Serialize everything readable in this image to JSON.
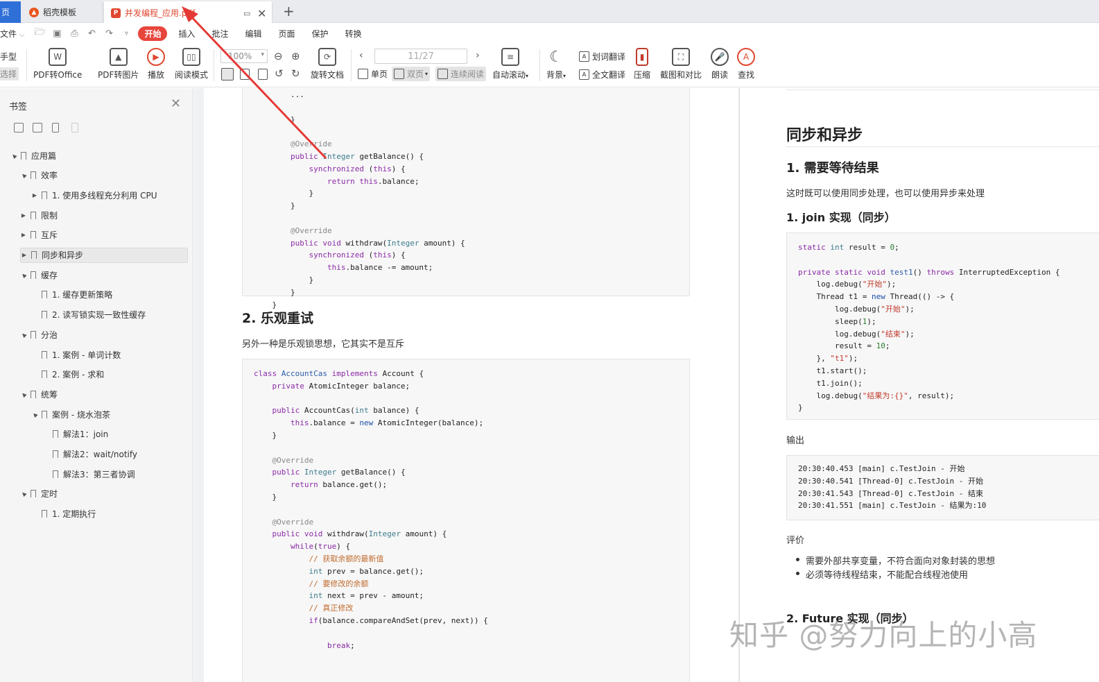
{
  "tabs": {
    "home_label": "页",
    "docer_label": "稻壳模板",
    "pdf_label": "并发编程_应用.pdf",
    "add_label": "+"
  },
  "menu": {
    "file_label": "文件",
    "start_label": "开始",
    "items": [
      "插入",
      "批注",
      "编辑",
      "页面",
      "保护",
      "转换"
    ]
  },
  "ribbon": {
    "hand_label": "手型",
    "select_label": "选择",
    "pdf_to_office": "PDF转Office",
    "pdf_to_image": "PDF转图片",
    "play": "播放",
    "read_mode": "阅读模式",
    "zoom": "100%",
    "rotate": "旋转文档",
    "page_indicator": "11/27",
    "single_page": "单页",
    "double_page": "双页",
    "continuous": "连续阅读",
    "auto_scroll": "自动滚动",
    "background": "背景",
    "word_translate": "划词翻译",
    "full_translate": "全文翻译",
    "compress": "压缩",
    "screenshot_compare": "截图和对比",
    "read_aloud": "朗读",
    "find": "查找"
  },
  "sidebar": {
    "title": "书签",
    "bookmarks": [
      {
        "label": "应用篇",
        "level": 0,
        "arrow": "▲"
      },
      {
        "label": "效率",
        "level": 1,
        "arrow": "▲"
      },
      {
        "label": "1. 使用多线程充分利用 CPU",
        "level": 2,
        "arrow": "▶"
      },
      {
        "label": "限制",
        "level": 1,
        "arrow": "▶"
      },
      {
        "label": "互斥",
        "level": 1,
        "arrow": "▶"
      },
      {
        "label": "同步和异步",
        "level": 1,
        "arrow": "▶"
      },
      {
        "label": "缓存",
        "level": 1,
        "arrow": "▲"
      },
      {
        "label": "1. 缓存更新策略",
        "level": 2,
        "arrow": ""
      },
      {
        "label": "2. 读写锁实现一致性缓存",
        "level": 2,
        "arrow": ""
      },
      {
        "label": "分治",
        "level": 1,
        "arrow": "▲"
      },
      {
        "label": "1. 案例 - 单词计数",
        "level": 2,
        "arrow": ""
      },
      {
        "label": "2. 案例 - 求和",
        "level": 2,
        "arrow": ""
      },
      {
        "label": "统筹",
        "level": 1,
        "arrow": "▲"
      },
      {
        "label": "案例 - 烧水泡茶",
        "level": 2,
        "arrow": "▲"
      },
      {
        "label": "解法1：join",
        "level": 3,
        "arrow": ""
      },
      {
        "label": "解法2：wait/notify",
        "level": 3,
        "arrow": ""
      },
      {
        "label": "解法3：第三者协调",
        "level": 3,
        "arrow": ""
      },
      {
        "label": "定时",
        "level": 1,
        "arrow": "▲"
      },
      {
        "label": "1. 定期执行",
        "level": 2,
        "arrow": ""
      }
    ]
  },
  "left_page": {
    "heading_retry": "2. 乐观重试",
    "retry_intro": "另外一种是乐观锁思想，它其实不是互斥"
  },
  "right_page": {
    "h_sync": "同步和异步",
    "h_wait": "1. 需要等待结果",
    "p_intro": "这时既可以使用同步处理，也可以使用异步来处理",
    "h_join": "1. join 实现（同步）",
    "output_label": "输出",
    "eval_label": "评价",
    "bullets": [
      "需要外部共享变量，不符合面向对象封装的思想",
      "必须等待线程结束，不能配合线程池使用"
    ],
    "h_future": "2. Future 实现（同步）"
  },
  "watermark": "知乎 @努力向上的小高"
}
